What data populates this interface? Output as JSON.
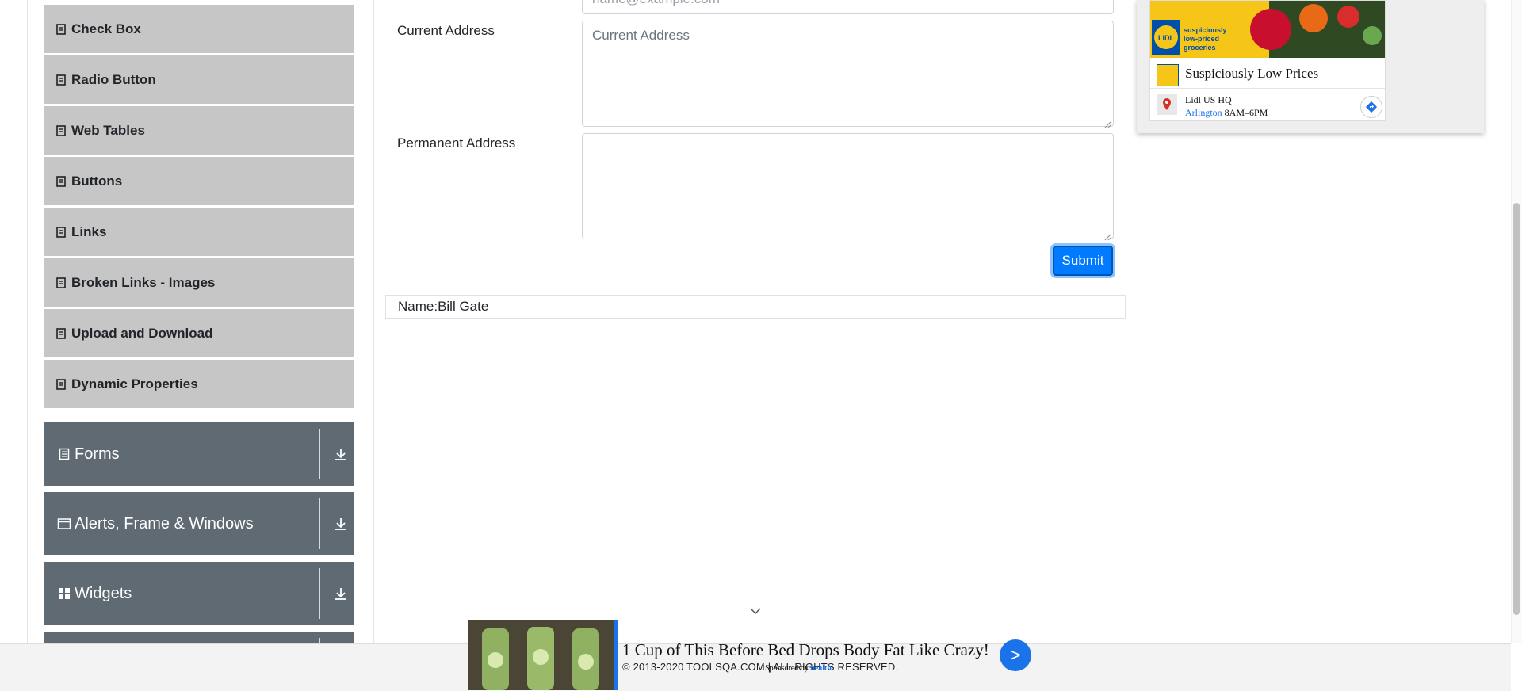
{
  "sidebar": {
    "element_items": [
      {
        "label": "Check Box",
        "icon": "doc-icon"
      },
      {
        "label": "Radio Button",
        "icon": "doc-icon"
      },
      {
        "label": "Web Tables",
        "icon": "doc-icon"
      },
      {
        "label": "Buttons",
        "icon": "doc-icon"
      },
      {
        "label": "Links",
        "icon": "doc-icon"
      },
      {
        "label": "Broken Links - Images",
        "icon": "doc-icon"
      },
      {
        "label": "Upload and Download",
        "icon": "doc-icon"
      },
      {
        "label": "Dynamic Properties",
        "icon": "doc-icon"
      }
    ],
    "groups": [
      {
        "label": "Forms",
        "icon": "form-icon"
      },
      {
        "label": "Alerts, Frame & Windows",
        "icon": "window-icon"
      },
      {
        "label": "Widgets",
        "icon": "grid-icon"
      }
    ]
  },
  "form": {
    "email_value": "name@example.com",
    "current_address_label": "Current Address",
    "current_address_placeholder": "Current Address",
    "permanent_address_label": "Permanent Address",
    "permanent_address_value": "",
    "submit_label": "Submit"
  },
  "output": {
    "name_line": "Name:Bill Gate"
  },
  "right_ad": {
    "tagline": "suspiciously low-priced groceries",
    "title": "Suspiciously Low Prices",
    "location_name": "Lidl US HQ",
    "city": "Arlington",
    "hours": "8AM–6PM",
    "logo_text": "LIDL"
  },
  "bottom_ad": {
    "headline": "1 Cup of This Before Bed Drops Body Fat Like Crazy!",
    "sponsor_prefix": "Sponsored by",
    "sponsor_brand": "health",
    "go_label": ">"
  },
  "footer": {
    "copyright": "© 2013-2020 TOOLSQA.COM | ALL RIGHTS RESERVED."
  },
  "colors": {
    "menu_item_bg": "#c6c6c6",
    "group_header_bg": "#5f6a72",
    "submit_bg": "#007bff",
    "ad_yellow": "#f5c518",
    "ad_blue": "#1a73e8"
  }
}
